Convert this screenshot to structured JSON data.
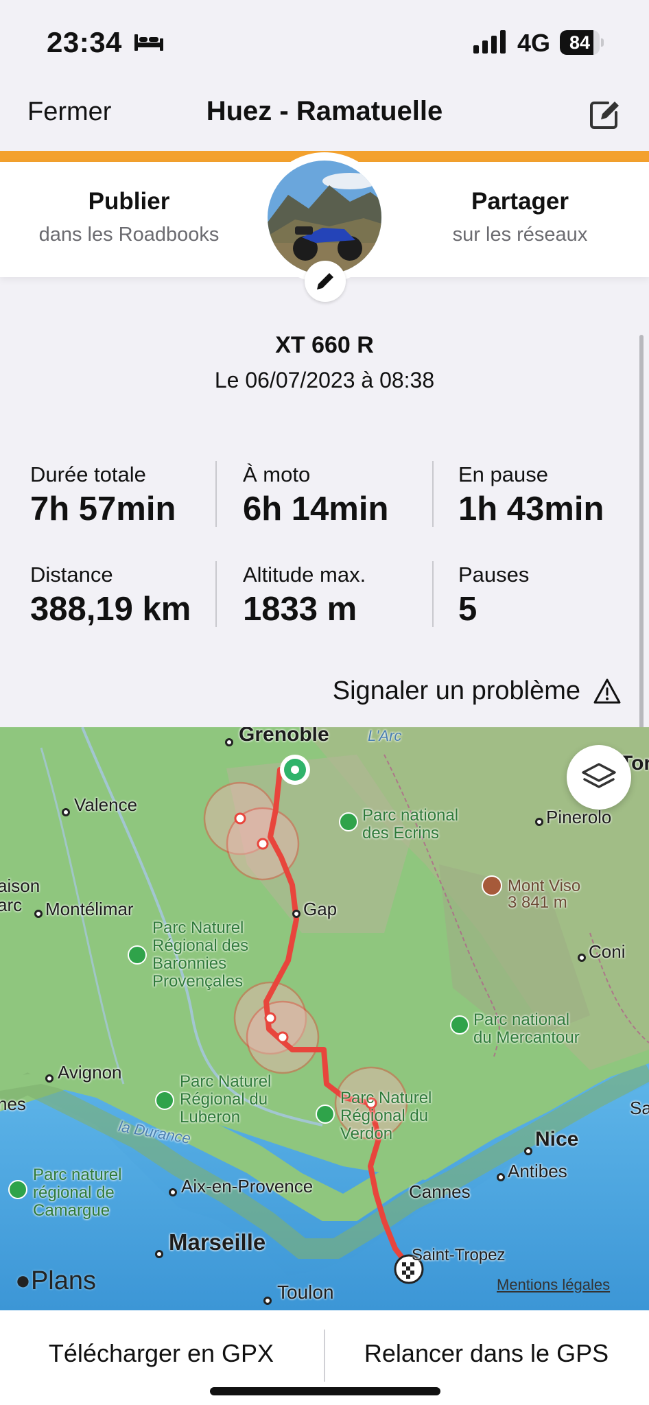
{
  "status_bar": {
    "time": "23:34",
    "network": "4G",
    "battery": "84",
    "battery_level": 0.84
  },
  "nav": {
    "close_label": "Fermer",
    "title": "Huez - Ramatuelle"
  },
  "header": {
    "publish_title": "Publier",
    "publish_sub": "dans les Roadbooks",
    "share_title": "Partager",
    "share_sub": "sur les réseaux"
  },
  "trip": {
    "bike": "XT 660 R",
    "date": "Le 06/07/2023 à 08:38"
  },
  "stats": [
    {
      "label": "Durée totale",
      "value": "7h 57min"
    },
    {
      "label": "À moto",
      "value": "6h 14min"
    },
    {
      "label": "En pause",
      "value": "1h 43min"
    },
    {
      "label": "Distance",
      "value": "388,19 km"
    },
    {
      "label": "Altitude max.",
      "value": "1833 m"
    },
    {
      "label": "Pauses",
      "value": "5"
    }
  ],
  "report_label": "Signaler un problème",
  "map": {
    "cities": [
      "Grenoble",
      "Valence",
      "Gap",
      "Montélimar",
      "Avignon",
      "Aix-en-Provence",
      "Marseille",
      "Toulon",
      "Cannes",
      "Antibes",
      "Nice",
      "Saint-Tropez",
      "Pinerolo",
      "Coni"
    ],
    "parks": [
      "Parc national\ndes Ecrins",
      "Parc Naturel\nRégional des\nBaronnies\nProvençales",
      "Parc national\ndu Mercantour",
      "Parc Naturel\nRégional du\nLuberon",
      "Parc Naturel\nRégional du\nVerdon",
      "Parc naturel\nrégional de\nCamargue"
    ],
    "mountain": "Mont Viso\n3 841 m",
    "rivers": [
      "la Durance",
      "L'Arc"
    ],
    "edge_labels": [
      "aison",
      "arc",
      "nes",
      "Tor",
      "Sa"
    ],
    "attribution": "Plans",
    "legal": "Mentions légales",
    "colors": {
      "route": "#e8453c",
      "sea": "#4aa3de",
      "land": "#8fc67e"
    }
  },
  "actions": {
    "gpx_label": "Télécharger en GPX",
    "gps_label": "Relancer dans le GPS"
  }
}
